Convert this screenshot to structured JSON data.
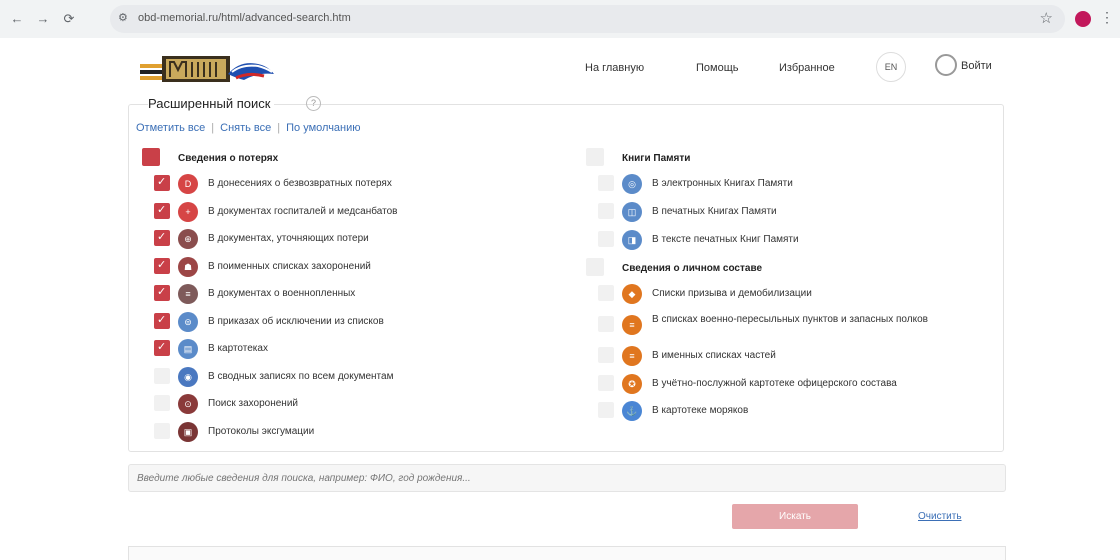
{
  "browser": {
    "url": "obd-memorial.ru/html/advanced-search.htm",
    "nav": {
      "back": "←",
      "forward": "→",
      "reload": "⟳"
    },
    "bookmark_icon": "☆",
    "menu_icon": "⋮"
  },
  "header": {
    "links": [
      "На главную",
      "Помощь",
      "Избранное"
    ],
    "lang": "EN",
    "login": "Войти"
  },
  "panel": {
    "title": "Расширенный поиск",
    "help_icon_text": "?",
    "toolbar": [
      "Отметить все",
      "Снять все",
      "По умолчанию"
    ],
    "toolbar_sep": "|"
  },
  "sections": {
    "losses": {
      "title": "Сведения о потерях",
      "checked": true,
      "items": [
        {
          "label": "В донесениях о безвозвратных потерях",
          "checked": true,
          "color": "#d64545",
          "glyph": "D"
        },
        {
          "label": "В документах госпиталей и медсанбатов",
          "checked": true,
          "color": "#d64545",
          "glyph": "+"
        },
        {
          "label": "В документах, уточняющих потери",
          "checked": true,
          "color": "#8a4d4d",
          "glyph": "⊕"
        },
        {
          "label": "В поименных списках захоронений",
          "checked": true,
          "color": "#9c4646",
          "glyph": "☗"
        },
        {
          "label": "В документах о военнопленных",
          "checked": true,
          "color": "#7e5a5a",
          "glyph": "≡"
        },
        {
          "label": "В приказах об исключении из списков",
          "checked": true,
          "color": "#5b8bc9",
          "glyph": "⊜"
        },
        {
          "label": "В картотеках",
          "checked": true,
          "color": "#5b8bc9",
          "glyph": "▤"
        },
        {
          "label": "В сводных записях по всем документам",
          "checked": false,
          "color": "#4a78c0",
          "glyph": "◉"
        },
        {
          "label": "Поиск захоронений",
          "checked": false,
          "color": "#8a3a3a",
          "glyph": "⊙"
        },
        {
          "label": "Протоколы эксгумации",
          "checked": false,
          "color": "#7a3535",
          "glyph": "▣"
        }
      ]
    },
    "memory_books": {
      "title": "Книги Памяти",
      "checked": false,
      "items": [
        {
          "label": "В электронных Книгах Памяти",
          "checked": false,
          "color": "#5b8bc9",
          "glyph": "◎"
        },
        {
          "label": "В печатных Книгах Памяти",
          "checked": false,
          "color": "#5b8bc9",
          "glyph": "◫"
        },
        {
          "label": "В тексте печатных Книг Памяти",
          "checked": false,
          "color": "#5b8bc9",
          "glyph": "◨"
        }
      ]
    },
    "personnel": {
      "title": "Сведения о личном составе",
      "checked": false,
      "items": [
        {
          "label": "Списки призыва и демобилизации",
          "checked": false,
          "color": "#e0761f",
          "glyph": "◆"
        },
        {
          "label": "В списках военно-пересыльных пунктов и запасных полков",
          "checked": false,
          "color": "#e0761f",
          "glyph": "≡",
          "wrap": true
        },
        {
          "label": "В именных списках частей",
          "checked": false,
          "color": "#e0761f",
          "glyph": "≡"
        },
        {
          "label": "В учётно-послужной картотеке офицерского состава",
          "checked": false,
          "color": "#e0761f",
          "glyph": "✪"
        },
        {
          "label": "В картотеке моряков",
          "checked": false,
          "color": "#4a86d4",
          "glyph": "⚓"
        }
      ]
    }
  },
  "search": {
    "placeholder": "Введите любые сведения для поиска, например: ФИО, год рождения..."
  },
  "actions": {
    "search": "Искать",
    "clear": "Очистить"
  }
}
